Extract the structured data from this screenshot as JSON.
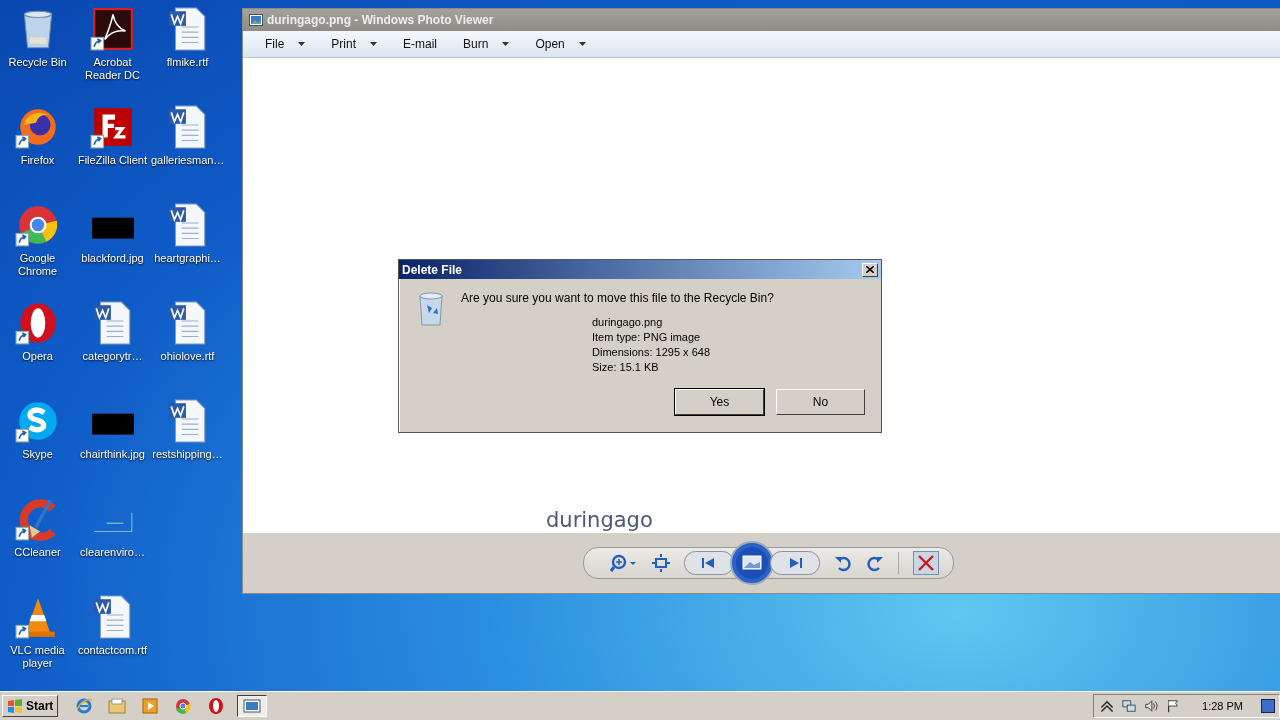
{
  "desktop_icons": [
    {
      "label": "Recycle Bin",
      "kind": "recycle",
      "shortcut": false
    },
    {
      "label": "Firefox",
      "kind": "firefox",
      "shortcut": true
    },
    {
      "label": "Google Chrome",
      "kind": "chrome",
      "shortcut": true
    },
    {
      "label": "Opera",
      "kind": "opera",
      "shortcut": true
    },
    {
      "label": "Skype",
      "kind": "skype",
      "shortcut": true
    },
    {
      "label": "CCleaner",
      "kind": "ccleaner",
      "shortcut": true
    },
    {
      "label": "VLC media player",
      "kind": "vlc",
      "shortcut": true
    },
    {
      "label": "Acrobat Reader DC",
      "kind": "acrobat",
      "shortcut": true
    },
    {
      "label": "FileZilla Client",
      "kind": "filezilla",
      "shortcut": true
    },
    {
      "label": "blackford.jpg",
      "kind": "image",
      "shortcut": false
    },
    {
      "label": "categorytr…",
      "kind": "document",
      "shortcut": false
    },
    {
      "label": "chairthink.jpg",
      "kind": "image",
      "shortcut": false
    },
    {
      "label": "clearenviro…",
      "kind": "blank-image",
      "shortcut": false
    },
    {
      "label": "contactcom.rtf",
      "kind": "document",
      "shortcut": false
    },
    {
      "label": "flmike.rtf",
      "kind": "document",
      "shortcut": false
    },
    {
      "label": "galleriesman…",
      "kind": "document",
      "shortcut": false
    },
    {
      "label": "heartgraphi…",
      "kind": "document",
      "shortcut": false
    },
    {
      "label": "ohiolove.rtf",
      "kind": "document",
      "shortcut": false
    },
    {
      "label": "restshipping…",
      "kind": "document",
      "shortcut": false
    }
  ],
  "window": {
    "title": "duringago.png - Windows Photo Viewer",
    "menu": [
      {
        "label": "File",
        "dropdown": true
      },
      {
        "label": "Print",
        "dropdown": true
      },
      {
        "label": "E-mail",
        "dropdown": false
      },
      {
        "label": "Burn",
        "dropdown": true
      },
      {
        "label": "Open",
        "dropdown": true
      }
    ],
    "caption": "duringago"
  },
  "dialog": {
    "title": "Delete File",
    "question": "Are you sure you want to move this file to the Recycle Bin?",
    "file_details": [
      "duringago.png",
      "Item type: PNG image",
      "Dimensions: 1295 x 648",
      "Size: 15.1 KB"
    ],
    "buttons": [
      {
        "label": "Yes",
        "default": true
      },
      {
        "label": "No",
        "default": false
      }
    ]
  },
  "taskbar": {
    "start": "Start",
    "apps": [
      {
        "kind": "ie",
        "active": false
      },
      {
        "kind": "explorer",
        "active": false
      },
      {
        "kind": "media",
        "active": false
      },
      {
        "kind": "chrome",
        "active": false
      },
      {
        "kind": "opera",
        "active": false
      },
      {
        "kind": "photos",
        "active": true
      }
    ],
    "clock": "1:28 PM"
  }
}
